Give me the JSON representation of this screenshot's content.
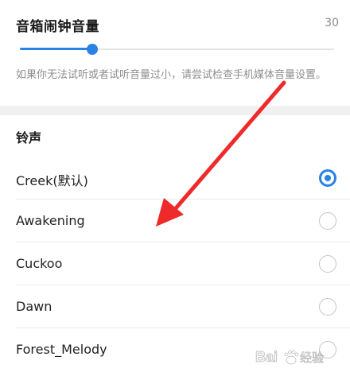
{
  "volume": {
    "title": "音箱闹钟音量",
    "value": "30",
    "level_percent": 23,
    "hint": "如果你无法试听或者试听音量过小，请尝试检查手机媒体音量设置。"
  },
  "ringtones": {
    "header": "铃声",
    "items": [
      {
        "label": "Creek(默认)",
        "selected": true
      },
      {
        "label": "Awakening",
        "selected": false
      },
      {
        "label": "Cuckoo",
        "selected": false
      },
      {
        "label": "Dawn",
        "selected": false
      },
      {
        "label": "Forest_Melody",
        "selected": false
      }
    ]
  },
  "colors": {
    "accent": "#2a82e4",
    "annotation": "#ee2a2a"
  },
  "watermark": {
    "text": "Baidu 经验"
  }
}
